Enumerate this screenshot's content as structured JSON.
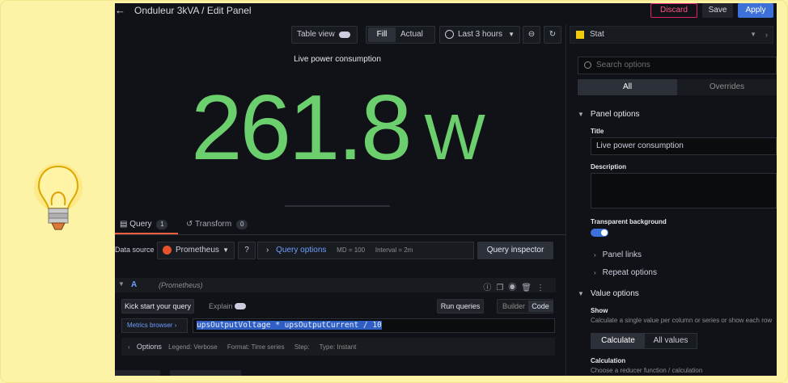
{
  "header": {
    "title": "Onduleur 3kVA / Edit Panel",
    "discard_label": "Discard",
    "save_label": "Save",
    "apply_label": "Apply"
  },
  "toolbar": {
    "table_view_label": "Table view",
    "fill_label": "Fill",
    "actual_label": "Actual",
    "time_range": "Last 3 hours"
  },
  "panel": {
    "title": "Live power consumption",
    "value": "261.8",
    "unit": "W",
    "value_color": "#6ccf6d"
  },
  "query_tabs": {
    "query_label": "Query",
    "query_count": "1",
    "transform_label": "Transform",
    "transform_count": "0"
  },
  "datasource": {
    "label": "Data source",
    "selected": "Prometheus",
    "query_options_label": "Query options",
    "md": "MD = 100",
    "interval": "Interval = 2m",
    "inspector_label": "Query inspector"
  },
  "query_a": {
    "ref": "A",
    "datasource": "(Prometheus)",
    "kick_start_label": "Kick start your query",
    "explain_label": "Explain",
    "run_label": "Run queries",
    "builder_label": "Builder",
    "code_label": "Code",
    "metrics_browser_label": "Metrics browser",
    "expression": "upsOutputVoltage * upsOutputCurrent / 10",
    "options_label": "Options",
    "legend": "Legend: Verbose",
    "format": "Format: Time series",
    "step": "Step:",
    "type": "Type: Instant"
  },
  "right_panel": {
    "visualization": "Stat",
    "search_placeholder": "Search options",
    "tab_all": "All",
    "tab_overrides": "Overrides",
    "panel_options_label": "Panel options",
    "title_label": "Title",
    "title_value": "Live power consumption",
    "description_label": "Description",
    "transparent_label": "Transparent background",
    "panel_links_label": "Panel links",
    "repeat_options_label": "Repeat options",
    "value_options_label": "Value options",
    "show_label": "Show",
    "show_desc": "Calculate a single value per column or series or show each row",
    "calculate_label": "Calculate",
    "all_values_label": "All values",
    "calculation_label": "Calculation",
    "calculation_desc": "Choose a reducer function / calculation"
  },
  "icons": {
    "bulb": "lightbulb-icon",
    "back": "arrow-left-icon"
  }
}
